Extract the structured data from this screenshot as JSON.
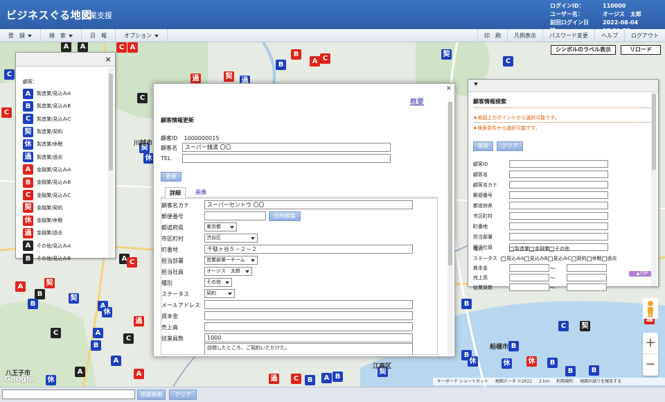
{
  "header": {
    "app_name": "ビジネスぐる地図",
    "app_sub": "営業支援",
    "login_info": [
      {
        "label": "ログインID：",
        "value": "110000"
      },
      {
        "label": "ユーザー名：",
        "value": "オージス　太郎"
      },
      {
        "label": "前回ログイン日時：",
        "value": "2022-08-04 17:21:52"
      }
    ]
  },
  "menu": {
    "left": [
      {
        "label": "登　録",
        "caret": true
      },
      {
        "label": "検　索",
        "caret": true
      },
      {
        "label": "日　報",
        "caret": false
      },
      {
        "label": "オプション",
        "caret": true
      }
    ],
    "right": [
      "印　刷",
      "凡例表示",
      "パスワード変更",
      "ヘルプ",
      "ログアウト"
    ]
  },
  "map": {
    "symbol_label_button": "シンボルのラベル表示",
    "reload_button": "リロード",
    "labels": [
      "川越市",
      "八王子市",
      "江東区",
      "船橋市"
    ],
    "attribution": [
      "キーボード ショートカット",
      "地図データ ©2022",
      "2 km",
      "利用規約",
      "地図の誤りを報告する"
    ],
    "google": "Google",
    "zoom_in": "+",
    "zoom_out": "−",
    "colors": {
      "blue": "#1b3fc0",
      "red": "#e2231a",
      "black": "#222222"
    }
  },
  "legend": {
    "close_icon": "×",
    "title": "顧客：",
    "items": [
      {
        "symbol": "A",
        "color": "blue",
        "label": "製造業/見込みA"
      },
      {
        "symbol": "B",
        "color": "blue",
        "label": "製造業/見込みB"
      },
      {
        "symbol": "C",
        "color": "blue",
        "label": "製造業/見込みC"
      },
      {
        "symbol": "契",
        "color": "blue",
        "label": "製造業/契約"
      },
      {
        "symbol": "休",
        "color": "blue",
        "label": "製造業/休眠"
      },
      {
        "symbol": "過",
        "color": "blue",
        "label": "製造業/過去"
      },
      {
        "symbol": "A",
        "color": "red",
        "label": "金融業/見込みA"
      },
      {
        "symbol": "B",
        "color": "red",
        "label": "金融業/見込みB"
      },
      {
        "symbol": "C",
        "color": "red",
        "label": "金融業/見込みC"
      },
      {
        "symbol": "契",
        "color": "red",
        "label": "金融業/契約"
      },
      {
        "symbol": "休",
        "color": "red",
        "label": "金融業/休眠"
      },
      {
        "symbol": "過",
        "color": "red",
        "label": "金融業/過去"
      },
      {
        "symbol": "A",
        "color": "black",
        "label": "その他/見込みA"
      },
      {
        "symbol": "B",
        "color": "black",
        "label": "その他/見込みB"
      }
    ]
  },
  "detail": {
    "close_icon": "×",
    "summary_link": "概要",
    "title": "顧客情報更新",
    "customer_id_label": "顧客ID",
    "customer_id": "1000000015",
    "customer_name_label": "顧客名",
    "customer_name": "スーパー銭湯 〇〇",
    "tel_label": "TEL",
    "tel": "",
    "update_button": "更新",
    "tabs": [
      "詳細",
      "画像"
    ],
    "fields": {
      "kana": {
        "label": "顧客名カナ",
        "value": "スーパーセントウ 〇〇"
      },
      "postal": {
        "label": "郵便番号",
        "value": ""
      },
      "address_search_button": "住所検索",
      "prefecture": {
        "label": "都道府県",
        "value": "東京都"
      },
      "city": {
        "label": "市区町村",
        "value": "渋谷区"
      },
      "street": {
        "label": "町番地",
        "value": "千駄ヶ谷５－２－２"
      },
      "department": {
        "label": "担当部署",
        "value": "営業部第一チーム"
      },
      "staff": {
        "label": "担当社員",
        "value": "オージス　太郎"
      },
      "type": {
        "label": "種別",
        "value": "その他"
      },
      "status": {
        "label": "ステータス",
        "value": "契約"
      },
      "email": {
        "label": "メールアドレス",
        "value": ""
      },
      "capital": {
        "label": "資本金",
        "value": ""
      },
      "sales": {
        "label": "売上高",
        "value": ""
      },
      "employees": {
        "label": "従業員数",
        "value": "1000"
      },
      "memo": "訪問したところ、ご契約いただけた。"
    }
  },
  "search": {
    "title": "顧客情報検索",
    "note1": "★地図上のポイントから選択可能です。",
    "note2": "★検索条件から選択可能です。",
    "search_button": "検索",
    "clear_button": "クリア",
    "field_labels": [
      "顧客ID",
      "顧客名",
      "顧客名カナ",
      "郵便番号",
      "都道府県",
      "市区町村",
      "町番地",
      "担当部署",
      "担当社員"
    ],
    "type_label": "種別",
    "type_options": [
      "製造業",
      "金融業",
      "その他"
    ],
    "status_label": "ステータス",
    "status_options": [
      "見込みA",
      "見込みB",
      "見込みC",
      "契約",
      "休眠",
      "過去"
    ],
    "range_labels": [
      "資本金",
      "売上高",
      "従業員数"
    ],
    "tilde": "～",
    "top_button": "▲TOP"
  },
  "bottom": {
    "search_input": "",
    "map_search_button": "地図検索",
    "clear_button": "クリア"
  }
}
